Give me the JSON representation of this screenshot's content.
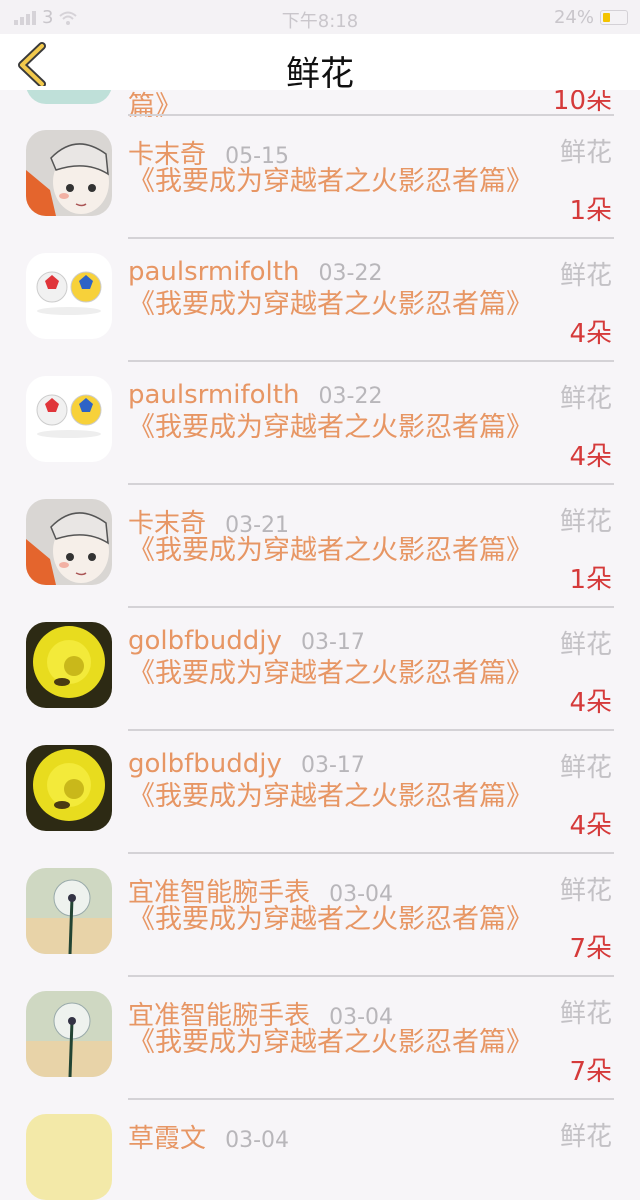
{
  "status_bar": {
    "carrier": "3",
    "time": "下午8:18",
    "battery": "24%"
  },
  "nav": {
    "title": "鲜花"
  },
  "partial_top": {
    "desc_tail": "篇》",
    "count": "10朵"
  },
  "rows": [
    {
      "avatar": "cartoon-girl-avatar",
      "name": "卡末奇",
      "date": "05-15",
      "desc": "《我要成为穿越者之火影忍者篇》",
      "kind": "鲜花",
      "count": "1朵"
    },
    {
      "avatar": "soccer-balls-avatar",
      "name": "paulsrmifolth",
      "date": "03-22",
      "desc": "《我要成为穿越者之火影忍者篇》",
      "kind": "鲜花",
      "count": "4朵"
    },
    {
      "avatar": "soccer-balls-avatar",
      "name": "paulsrmifolth",
      "date": "03-22",
      "desc": "《我要成为穿越者之火影忍者篇》",
      "kind": "鲜花",
      "count": "4朵"
    },
    {
      "avatar": "cartoon-girl-avatar",
      "name": "卡末奇",
      "date": "03-21",
      "desc": "《我要成为穿越者之火影忍者篇》",
      "kind": "鲜花",
      "count": "1朵"
    },
    {
      "avatar": "yellow-flower-avatar",
      "name": "golbfbuddjy",
      "date": "03-17",
      "desc": "《我要成为穿越者之火影忍者篇》",
      "kind": "鲜花",
      "count": "4朵"
    },
    {
      "avatar": "yellow-flower-avatar",
      "name": "golbfbuddjy",
      "date": "03-17",
      "desc": "《我要成为穿越者之火影忍者篇》",
      "kind": "鲜花",
      "count": "4朵"
    },
    {
      "avatar": "dandelion-avatar",
      "name": "宜准智能腕手表",
      "date": "03-04",
      "desc": "《我要成为穿越者之火影忍者篇》",
      "kind": "鲜花",
      "count": "7朵"
    },
    {
      "avatar": "dandelion-avatar",
      "name": "宜准智能腕手表",
      "date": "03-04",
      "desc": "《我要成为穿越者之火影忍者篇》",
      "kind": "鲜花",
      "count": "7朵"
    }
  ],
  "partial_bottom": {
    "name": "草霞文",
    "date": "03-04",
    "kind": "鲜花"
  }
}
